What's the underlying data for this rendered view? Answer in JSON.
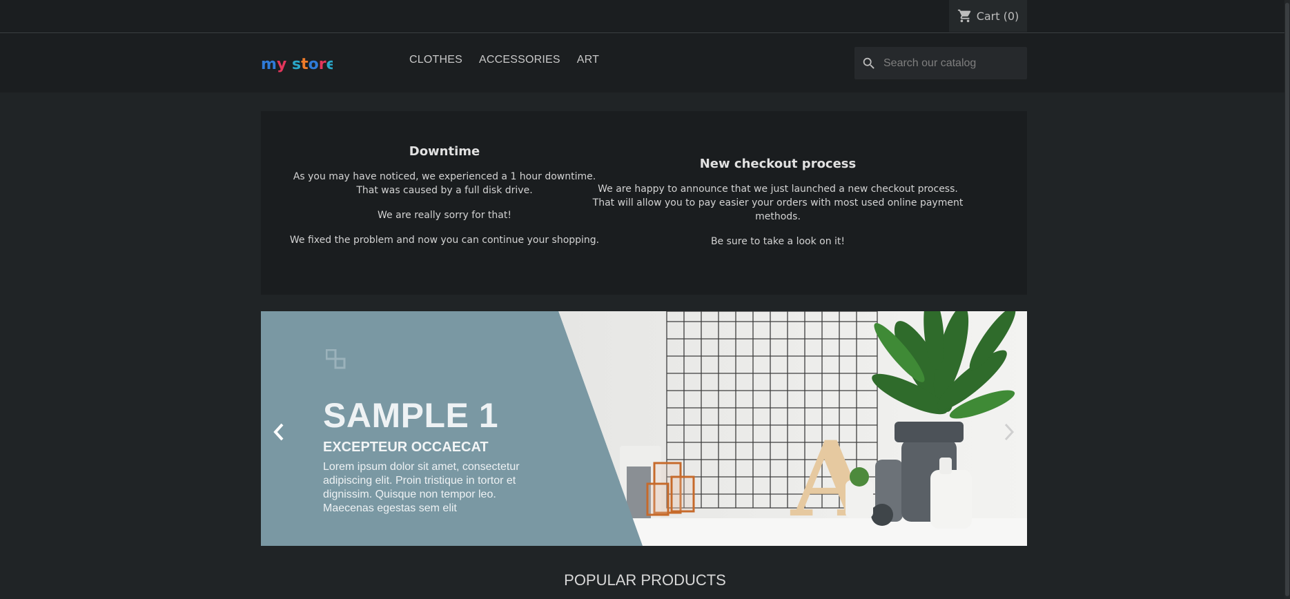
{
  "topbar": {
    "cart_label": "Cart (0)",
    "cart_icon": "shopping-cart-icon"
  },
  "header": {
    "logo_text": "my store",
    "nav": [
      {
        "label": "CLOTHES"
      },
      {
        "label": "ACCESSORIES"
      },
      {
        "label": "ART"
      }
    ],
    "search": {
      "placeholder": "Search our catalog",
      "value": ""
    }
  },
  "custom_text": {
    "left": {
      "title": "Downtime",
      "line1": "As you may have noticed, we experienced a 1 hour downtime.",
      "line2": "That was caused by a full disk drive.",
      "para2": "We are really sorry for that!",
      "para3": "We fixed the problem and now you can continue your shopping."
    },
    "right": {
      "title": "New checkout process",
      "line1": "We are happy to announce that we just launched a new checkout process.",
      "line2": "That will allow you to pay easier your orders with most used online payment methods.",
      "para2": "Be sure to take a look on it!"
    }
  },
  "slider": {
    "title": "SAMPLE 1",
    "subtitle": "EXCEPTEUR OCCAECAT",
    "text": "Lorem ipsum dolor sit amet, consectetur adipiscing elit. Proin tristique in tortor et dignissim. Quisque non tempor leo. Maecenas egestas sem elit"
  },
  "sections": {
    "popular_title": "POPULAR PRODUCTS"
  },
  "colors": {
    "page_bg": "#202426",
    "header_bg": "#1b1e20",
    "slide_bg": "#7a98a3"
  }
}
